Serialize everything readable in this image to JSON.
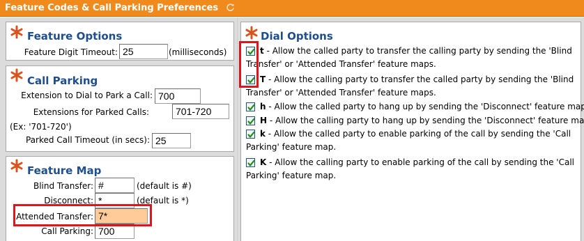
{
  "header": {
    "title": "Feature Codes & Call Parking Preferences"
  },
  "feature_options": {
    "title": "Feature Options",
    "digit_timeout_label": "Feature Digit Timeout:",
    "digit_timeout_value": "25",
    "digit_timeout_unit": "(milliseconds)"
  },
  "call_parking": {
    "title": "Call Parking",
    "ext_label": "Extension to Dial to Park a Call:",
    "ext_value": "700",
    "parked_label": "Extensions for Parked Calls:",
    "parked_value": "701-720",
    "example": "(Ex: '701-720')",
    "timeout_label": "Parked Call Timeout (in secs):",
    "timeout_value": "25"
  },
  "feature_map": {
    "title": "Feature Map",
    "blind_label": "Blind Transfer:",
    "blind_value": "#",
    "blind_default": "(default is #)",
    "disconnect_label": "Disconnect:",
    "disconnect_value": "*",
    "disconnect_default": "(default is *)",
    "attended_label": "Attended Transfer:",
    "attended_value": "7*",
    "parking_label": "Call Parking:",
    "parking_value": "700"
  },
  "dial_options": {
    "title": "Dial Options",
    "items": [
      {
        "key": "t",
        "checked": true,
        "line1": " - Allow the called party to transfer the calling party by sending the 'Blind",
        "line2": "Transfer' or 'Attended Transfer' feature maps."
      },
      {
        "key": "T",
        "checked": true,
        "line1": " - Allow the calling party to transfer the called party by sending the 'Blind",
        "line2": "Transfer' or 'Attended Transfer' feature maps."
      },
      {
        "key": "h",
        "checked": true,
        "line1": " - Allow the called party to hang up by sending the 'Disconnect' feature map.",
        "line2": ""
      },
      {
        "key": "H",
        "checked": true,
        "line1": " - Allow the calling party to hang up by sending the 'Disconnect' feature map.",
        "line2": ""
      },
      {
        "key": "k",
        "checked": true,
        "line1": " - Allow the called party to enable parking of the call by sending the 'Call",
        "line2": "Parking' feature map."
      },
      {
        "key": "K",
        "checked": true,
        "line1": " - Allow the calling party to enable parking of the call by sending the 'Call",
        "line2": "Parking' feature map."
      }
    ]
  },
  "colors": {
    "header_bg": "#f18a1d",
    "section_title": "#1f4e8f",
    "highlight_box": "#e0141b",
    "field_highlight": "#ffcc99",
    "star": "#d9531e"
  },
  "icons": {
    "refresh": "refresh-icon",
    "section": "star-icon",
    "check": "checkbox-checked-icon"
  }
}
